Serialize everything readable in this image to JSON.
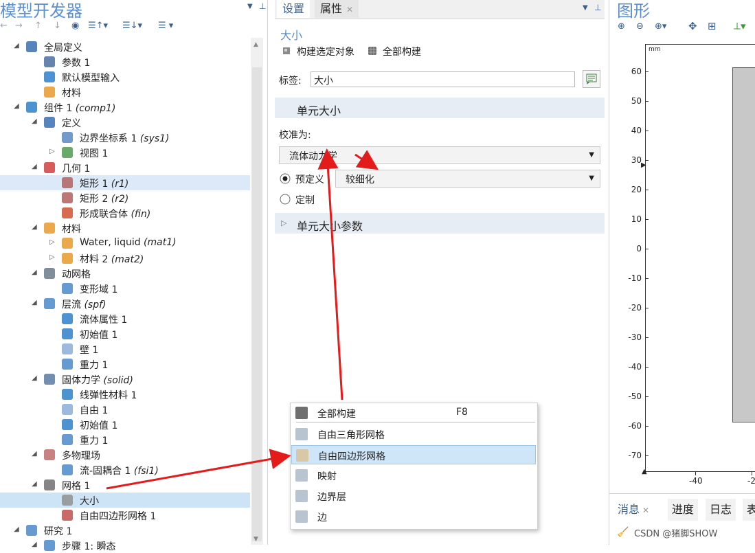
{
  "left_panel": {
    "title": "模型开发器",
    "tree": [
      {
        "label": "全局定义",
        "icon": "globe-icon"
      },
      {
        "label": "参数 1",
        "icon": "parameter-icon"
      },
      {
        "label": "默认模型输入",
        "icon": "model-input-icon"
      },
      {
        "label": "材料",
        "icon": "materials-icon"
      },
      {
        "label": "组件 1",
        "tag": "(comp1)",
        "icon": "component-icon"
      },
      {
        "label": "定义",
        "icon": "definitions-icon"
      },
      {
        "label": "边界坐标系 1",
        "tag": "(sys1)",
        "icon": "coordinate-system-icon"
      },
      {
        "label": "视图 1",
        "icon": "view-icon"
      },
      {
        "label": "几何 1",
        "icon": "geometry-icon"
      },
      {
        "label": "矩形 1",
        "tag": "(r1)",
        "icon": "rectangle-icon"
      },
      {
        "label": "矩形 2",
        "tag": "(r2)",
        "icon": "rectangle-icon"
      },
      {
        "label": "形成联合体",
        "tag": "(fin)",
        "icon": "form-union-icon"
      },
      {
        "label": "材料",
        "icon": "materials-icon"
      },
      {
        "label": "Water, liquid",
        "tag": "(mat1)",
        "icon": "material-icon"
      },
      {
        "label": "材料 2",
        "tag": "(mat2)",
        "icon": "material-icon"
      },
      {
        "label": "动网格",
        "icon": "moving-mesh-icon"
      },
      {
        "label": "变形域 1",
        "icon": "deforming-domain-icon"
      },
      {
        "label": "层流",
        "tag": "(spf)",
        "icon": "laminar-flow-icon"
      },
      {
        "label": "流体属性 1",
        "icon": "fluid-properties-icon"
      },
      {
        "label": "初始值 1",
        "icon": "initial-values-icon"
      },
      {
        "label": "壁 1",
        "icon": "wall-icon"
      },
      {
        "label": "重力 1",
        "icon": "gravity-icon"
      },
      {
        "label": "固体力学",
        "tag": "(solid)",
        "icon": "solid-mechanics-icon"
      },
      {
        "label": "线弹性材料 1",
        "icon": "linear-elastic-icon"
      },
      {
        "label": "自由 1",
        "icon": "free-icon"
      },
      {
        "label": "初始值 1",
        "icon": "initial-values-icon"
      },
      {
        "label": "重力 1",
        "icon": "gravity-icon"
      },
      {
        "label": "多物理场",
        "icon": "multiphysics-icon"
      },
      {
        "label": "流-固耦合 1",
        "tag": "(fsi1)",
        "icon": "fsi-icon"
      },
      {
        "label": "网格 1",
        "icon": "mesh-icon"
      },
      {
        "label": "大小",
        "icon": "size-icon"
      },
      {
        "label": "自由四边形网格 1",
        "icon": "free-quad-icon"
      },
      {
        "label": "研究 1",
        "icon": "study-icon"
      },
      {
        "label": "步骤 1: 瞬态",
        "icon": "step-icon"
      }
    ]
  },
  "settings": {
    "tab_settings": "设置",
    "tab_properties": "属性",
    "heading": "大小",
    "build_selected": "构建选定对象",
    "build_all": "全部构建",
    "label_caption": "标签:",
    "label_value": "大小",
    "section_element_size": "单元大小",
    "calibrate_caption": "校准为:",
    "calibrate_value": "流体动力学",
    "predefined": "预定义",
    "predefined_value": "较细化",
    "custom": "定制",
    "section_params": "单元大小参数"
  },
  "graphics": {
    "title": "图形",
    "unit": "mm",
    "y_ticks": [
      "60",
      "50",
      "40",
      "30",
      "20",
      "10",
      "0",
      "-10",
      "-20",
      "-30",
      "-40",
      "-50",
      "-60",
      "-70"
    ],
    "x_ticks": [
      "-40",
      "-2"
    ]
  },
  "context_menu": {
    "items": [
      {
        "label": "全部构建",
        "shortcut": "F8",
        "icon": "build-all-icon"
      },
      {
        "label": "自由三角形网格",
        "shortcut": "",
        "icon": "free-triangular-icon"
      },
      {
        "label": "自由四边形网格",
        "shortcut": "",
        "icon": "free-quad-icon"
      },
      {
        "label": "映射",
        "shortcut": "",
        "icon": "mapped-icon"
      },
      {
        "label": "边界层",
        "shortcut": "",
        "icon": "boundary-layer-icon"
      },
      {
        "label": "边",
        "shortcut": "",
        "icon": "edge-icon"
      }
    ]
  },
  "bottom_tabs": [
    "消息",
    "进度",
    "日志",
    "表"
  ],
  "watermark": "CSDN @猪脚SHOW",
  "colors": {
    "selection": "#dbe9f8",
    "band": "#e7edf5",
    "annotation_arrow": "#e41b1b",
    "title": "#5b8fd0"
  }
}
